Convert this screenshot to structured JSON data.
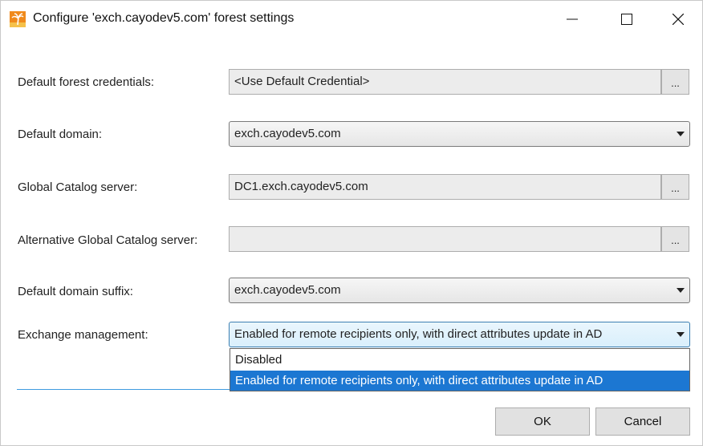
{
  "window": {
    "title": "Configure 'exch.cayodev5.com' forest settings",
    "icon": "palm-tree-icon",
    "controls": [
      "minimize-icon",
      "maximize-icon",
      "close-icon"
    ]
  },
  "form": {
    "credentials": {
      "label": "Default forest credentials:",
      "value": "<Use Default Credential>",
      "browse_label": "..."
    },
    "domain": {
      "label": "Default domain:",
      "value": "exch.cayodev5.com"
    },
    "gc_server": {
      "label": "Global Catalog server:",
      "value": "DC1.exch.cayodev5.com",
      "browse_label": "..."
    },
    "alt_gc_server": {
      "label": "Alternative Global Catalog server:",
      "value": "",
      "browse_label": "..."
    },
    "domain_suffix": {
      "label": "Default domain suffix:",
      "value": "exch.cayodev5.com"
    },
    "exchange_mgmt": {
      "label": "Exchange management:",
      "value": "Enabled for remote recipients only, with direct attributes update in AD",
      "options": [
        "Disabled",
        "Enabled for remote recipients only, with direct attributes update in AD"
      ],
      "selected_index": 1
    }
  },
  "buttons": {
    "ok": "OK",
    "cancel": "Cancel"
  },
  "colors": {
    "selection": "#1c77d2",
    "focus_border": "#3c7fb1",
    "separator": "#3f9be0"
  }
}
